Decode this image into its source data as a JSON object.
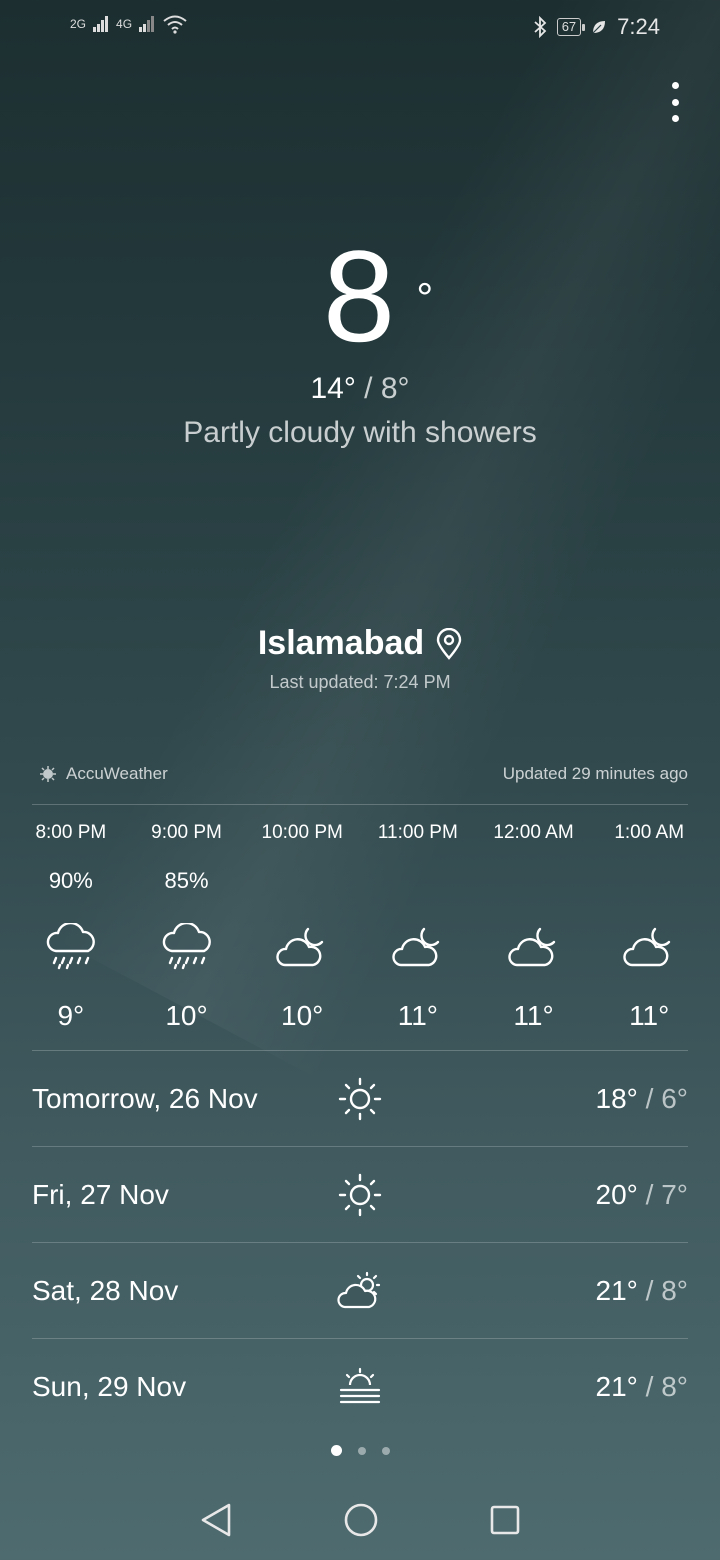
{
  "status_bar": {
    "signal1": "2G",
    "signal2": "4G",
    "battery": "67",
    "time": "7:24"
  },
  "current": {
    "temp": "8",
    "degree_symbol": "°",
    "high": "14°",
    "separator": " / ",
    "low": "8°",
    "condition": "Partly cloudy with showers"
  },
  "location": {
    "city": "Islamabad",
    "last_updated": "Last updated: 7:24 PM"
  },
  "provider": {
    "name": "AccuWeather",
    "updated": "Updated 29 minutes ago"
  },
  "hourly": [
    {
      "time": "8:00 PM",
      "precip": "90%",
      "icon": "rain-icon",
      "temp": "9°"
    },
    {
      "time": "9:00 PM",
      "precip": "85%",
      "icon": "rain-icon",
      "temp": "10°"
    },
    {
      "time": "10:00 PM",
      "precip": "",
      "icon": "cloudy-night-icon",
      "temp": "10°"
    },
    {
      "time": "11:00 PM",
      "precip": "",
      "icon": "cloudy-night-icon",
      "temp": "11°"
    },
    {
      "time": "12:00 AM",
      "precip": "",
      "icon": "cloudy-night-icon",
      "temp": "11°"
    },
    {
      "time": "1:00 AM",
      "precip": "",
      "icon": "cloudy-night-icon",
      "temp": "11°"
    }
  ],
  "daily": [
    {
      "label": "Tomorrow, 26 Nov",
      "icon": "sun-icon",
      "high": "18°",
      "low": "6°"
    },
    {
      "label": "Fri, 27 Nov",
      "icon": "sun-icon",
      "high": "20°",
      "low": "7°"
    },
    {
      "label": "Sat, 28 Nov",
      "icon": "partly-sunny-icon",
      "high": "21°",
      "low": "8°"
    },
    {
      "label": "Sun, 29 Nov",
      "icon": "haze-icon",
      "high": "21°",
      "low": "8°"
    }
  ],
  "pager": {
    "count": 3,
    "active": 0
  }
}
